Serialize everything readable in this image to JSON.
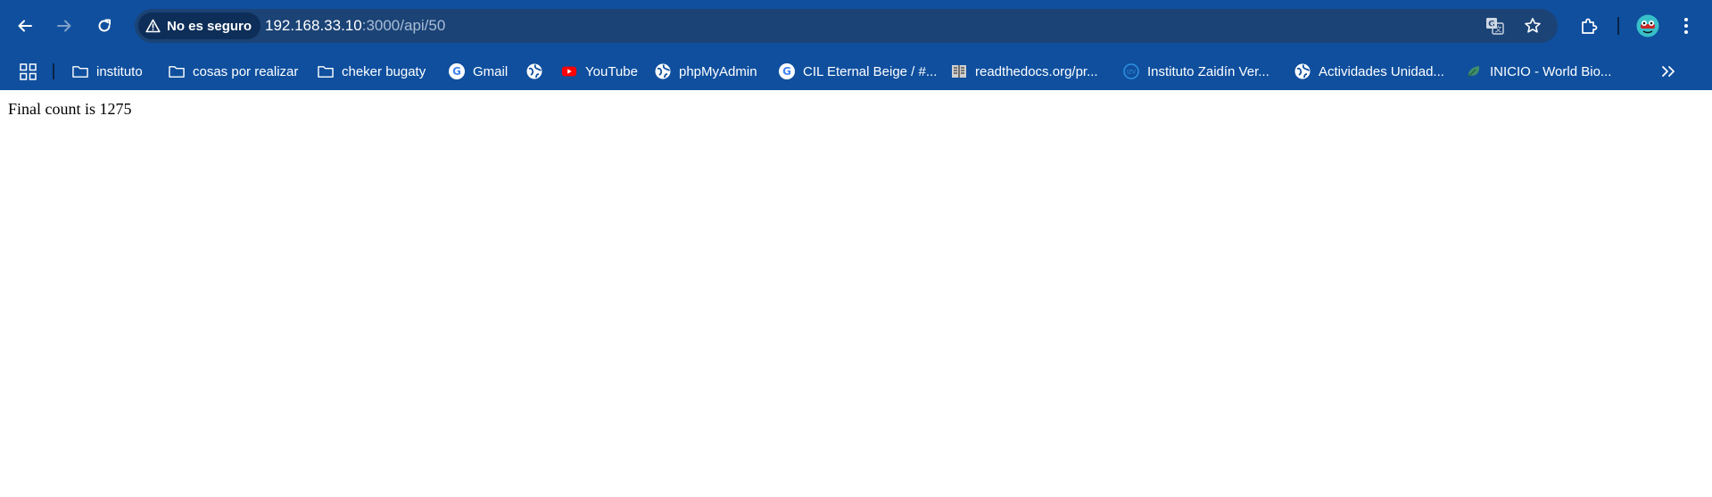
{
  "browser": {
    "security_chip": "No es seguro",
    "url_host": "192.168.33.10",
    "url_path": ":3000/api/50",
    "colors": {
      "frame": "#0f4f9e",
      "omnibox": "#1b4376",
      "chip": "#0d2e58"
    }
  },
  "bookmarks": [
    {
      "label": "instituto",
      "icon": "folder-icon"
    },
    {
      "label": "cosas por realizar",
      "icon": "folder-icon"
    },
    {
      "label": "cheker bugaty",
      "icon": "folder-icon"
    },
    {
      "label": "Gmail",
      "icon": "google-icon"
    },
    {
      "label": "",
      "icon": "globe-icon"
    },
    {
      "label": "YouTube",
      "icon": "youtube-icon"
    },
    {
      "label": "phpMyAdmin",
      "icon": "globe-icon"
    },
    {
      "label": "CIL Eternal Beige / #...",
      "icon": "google-icon"
    },
    {
      "label": "readthedocs.org/pr...",
      "icon": "docs-icon"
    },
    {
      "label": "Instituto Zaidín Ver...",
      "icon": "school-icon"
    },
    {
      "label": "Actividades Unidad...",
      "icon": "globe-icon"
    },
    {
      "label": "INICIO - World Bio...",
      "icon": "leaf-icon"
    }
  ],
  "page": {
    "text": "Final count is 1275"
  }
}
